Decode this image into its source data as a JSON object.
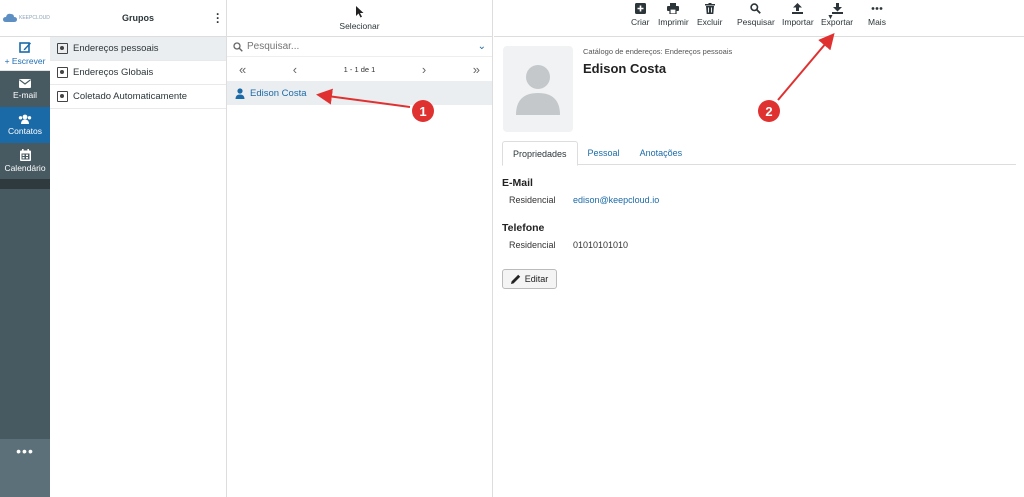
{
  "nav": {
    "logo_text": "KEEPCLOUD",
    "compose_label": "+ Escrever",
    "items": [
      {
        "label": "E-mail",
        "icon": "mail-icon"
      },
      {
        "label": "Contatos",
        "icon": "contacts-icon"
      },
      {
        "label": "Calendário",
        "icon": "calendar-icon"
      }
    ],
    "more": "•••"
  },
  "groups": {
    "title": "Grupos",
    "items": [
      {
        "label": "Endereços pessoais",
        "selected": true
      },
      {
        "label": "Endereços Globais"
      },
      {
        "label": "Coletado Automaticamente"
      }
    ]
  },
  "contacts": {
    "select_label": "Selecionar",
    "search_placeholder": "Pesquisar...",
    "pager_info": "1 - 1 de 1",
    "list": [
      {
        "name": "Edison Costa"
      }
    ]
  },
  "toolbar": {
    "create": "Criar",
    "print": "Imprimir",
    "delete": "Excluir",
    "search": "Pesquisar",
    "import": "Importar",
    "export": "Exportar",
    "more": "Mais"
  },
  "contact": {
    "breadcrumb": "Catálogo de endereços: Endereços pessoais",
    "name": "Edison Costa",
    "tabs": [
      "Propriedades",
      "Pessoal",
      "Anotações"
    ],
    "email_section": "E-Mail",
    "email_label": "Residencial",
    "email_value": "edison@keepcloud.io",
    "phone_section": "Telefone",
    "phone_label": "Residencial",
    "phone_value": "01010101010",
    "edit_label": "Editar"
  },
  "annotations": {
    "badge1": "1",
    "badge2": "2",
    "arrow_color": "#e03131"
  },
  "colors": {
    "accent": "#1b6aa8",
    "nav_bg": "#485a61"
  }
}
